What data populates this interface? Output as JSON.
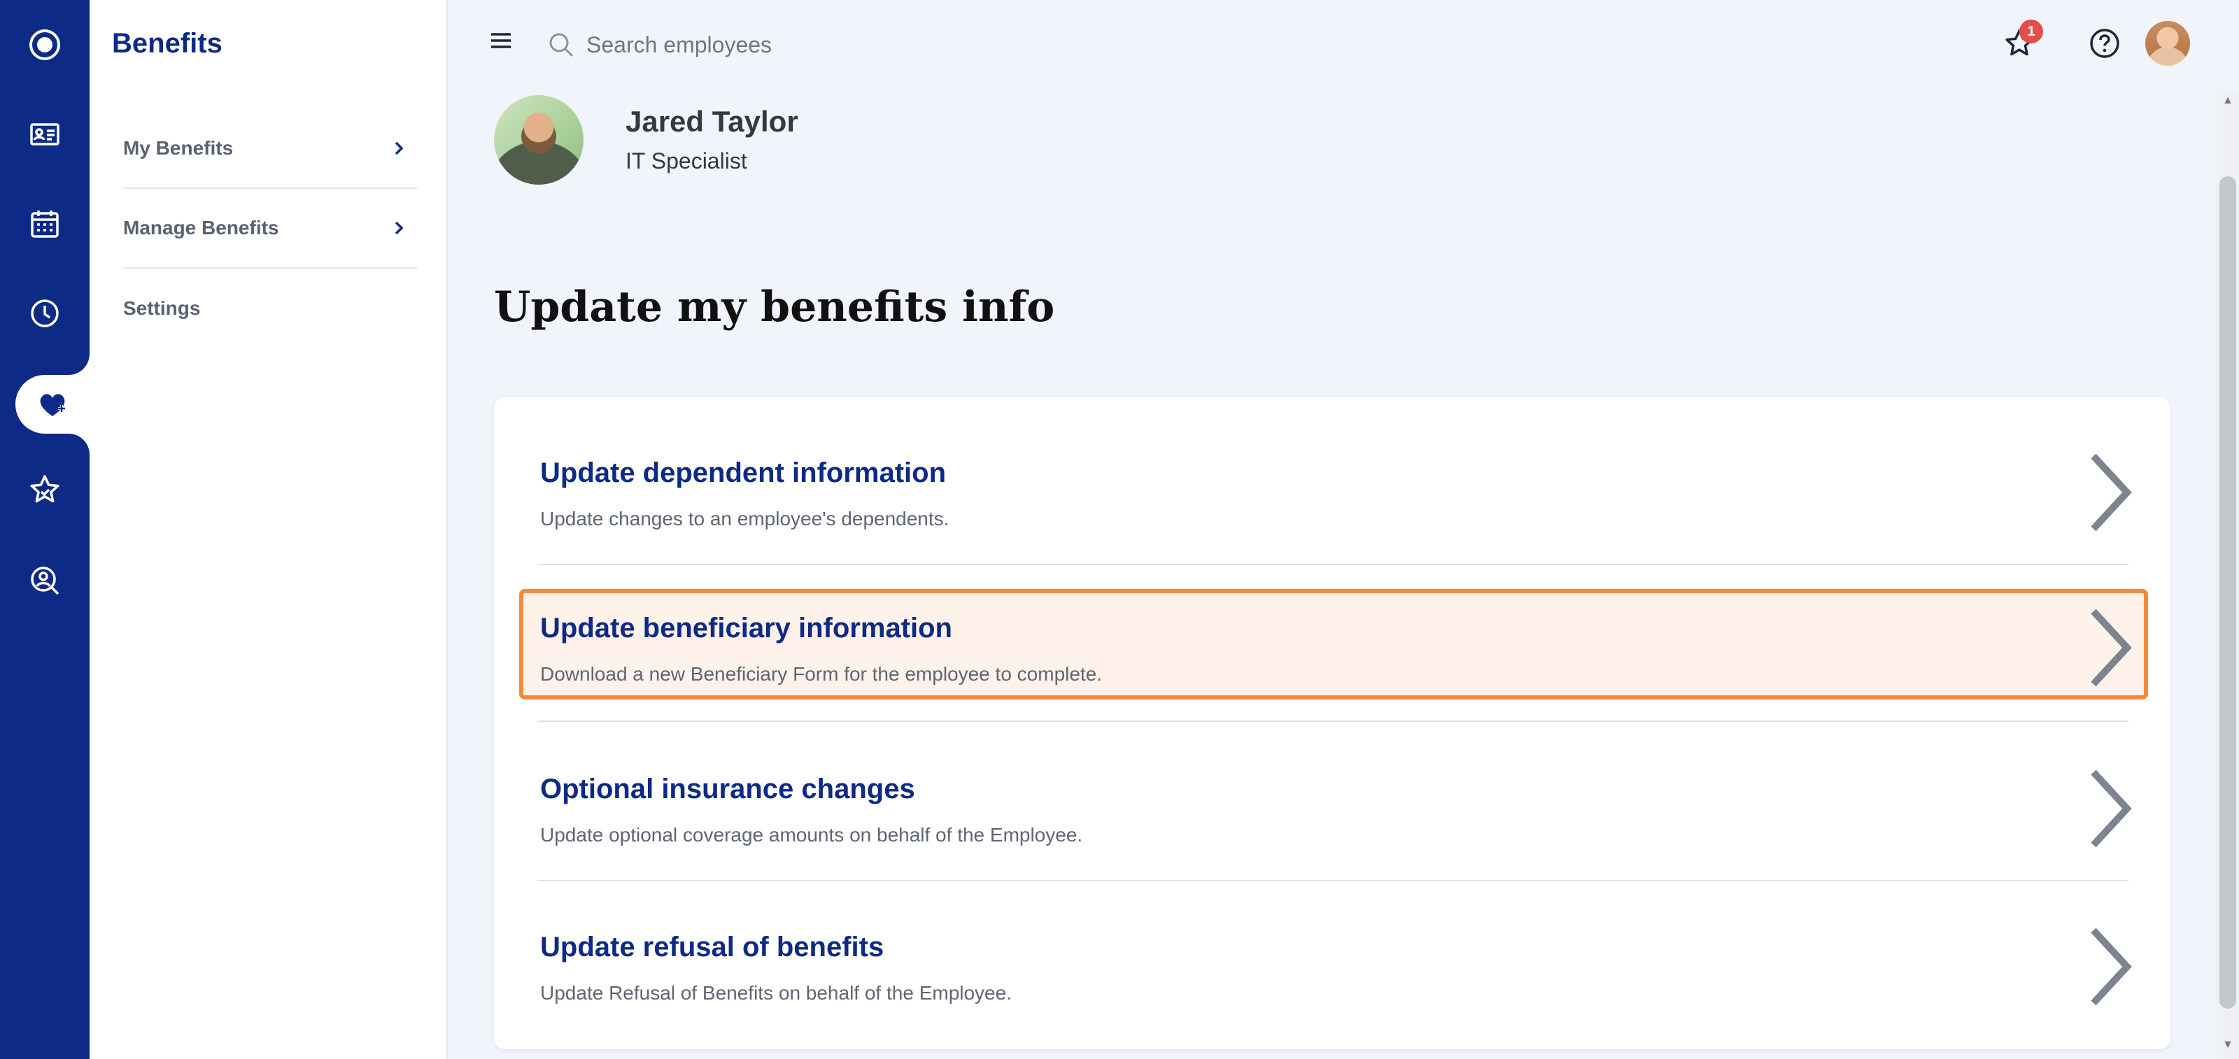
{
  "icons": {
    "rail": [
      "logo-icon",
      "id-card-icon",
      "calendar-icon",
      "clock-icon",
      "heart-benefits-icon",
      "star-icon",
      "search-person-icon"
    ],
    "menu": "hamburger-icon",
    "search": "search-icon",
    "favorites": "star-icon",
    "help": "help-icon",
    "chevron": "chevron-right-icon"
  },
  "colors": {
    "brand_navy": "#0e2a87",
    "highlight_border": "#f28a3c",
    "highlight_bg": "#fff2ea",
    "badge": "#e34d4d",
    "page_bg": "#f1f4fb"
  },
  "sidebar": {
    "title": "Benefits",
    "items": [
      {
        "label": "My Benefits",
        "has_chevron": true
      },
      {
        "label": "Manage Benefits",
        "has_chevron": true
      },
      {
        "label": "Settings",
        "has_chevron": false
      }
    ]
  },
  "header": {
    "search_placeholder": "Search employees",
    "notification_count": "1"
  },
  "profile": {
    "name": "Jared Taylor",
    "role": "IT Specialist"
  },
  "main": {
    "title": "Update my benefits info",
    "options": [
      {
        "title": "Update dependent information",
        "description": "Update changes to an employee's dependents.",
        "highlighted": false
      },
      {
        "title": "Update beneficiary information",
        "description": "Download a new Beneficiary Form for the employee to complete.",
        "highlighted": true
      },
      {
        "title": "Optional insurance changes",
        "description": "Update optional coverage amounts on behalf of the Employee.",
        "highlighted": false
      },
      {
        "title": "Update refusal of benefits",
        "description": "Update Refusal of Benefits on behalf of the Employee.",
        "highlighted": false
      }
    ]
  }
}
